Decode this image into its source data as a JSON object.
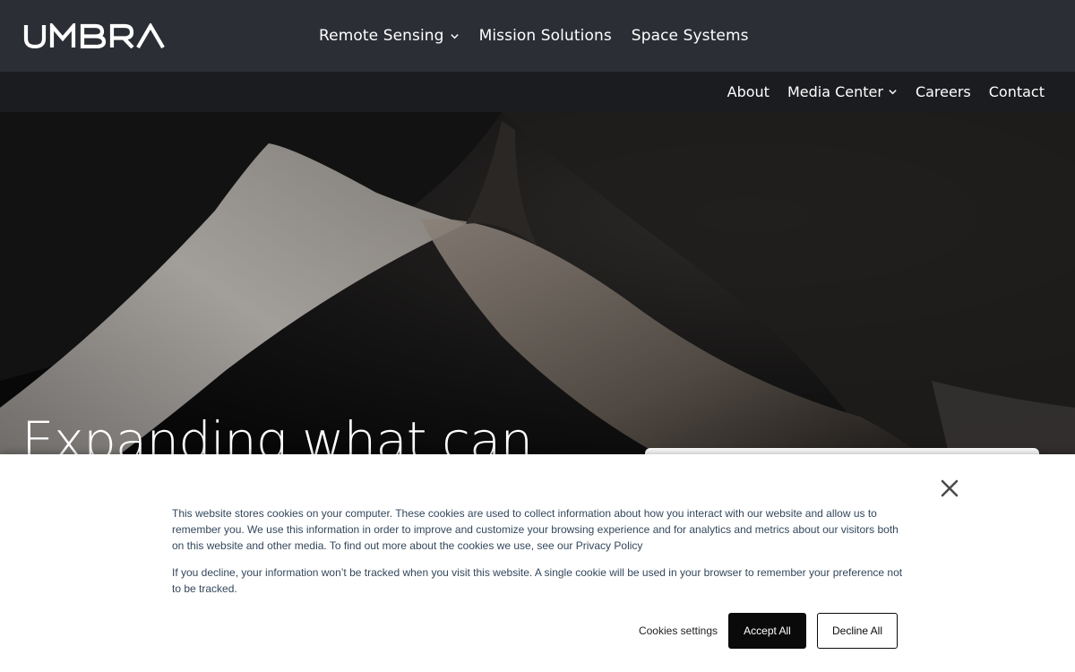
{
  "brand": {
    "logo_text": "UMBRA"
  },
  "main_nav": {
    "items": [
      {
        "label": "Remote Sensing",
        "has_dropdown": true
      },
      {
        "label": "Mission Solutions",
        "has_dropdown": false
      },
      {
        "label": "Space Systems",
        "has_dropdown": false
      }
    ]
  },
  "secondary_nav": {
    "items": [
      {
        "label": "About",
        "has_dropdown": false
      },
      {
        "label": "Media Center",
        "has_dropdown": true
      },
      {
        "label": "Careers",
        "has_dropdown": false
      },
      {
        "label": "Contact",
        "has_dropdown": false
      }
    ]
  },
  "hero": {
    "title": "Expanding what can"
  },
  "cookie_banner": {
    "paragraph_1": "This website stores cookies on your computer. These cookies are used to collect information about how you interact with our website and allow us to remember you. We use this information in order to improve and customize your browsing experience and for analytics and metrics about our visitors both on this website and other media. To find out more about the cookies we use, see our Privacy Policy",
    "paragraph_2": "If you decline, your information won’t be tracked when you visit this website. A single cookie will be used in your browser to remember your preference not to be tracked.",
    "settings_label": "Cookies settings",
    "accept_label": "Accept All",
    "decline_label": "Decline All",
    "close_icon": "close-icon"
  },
  "colors": {
    "topbar": "#2b2e35",
    "subbar": "#1b1c20",
    "accept_button": "#0a0a0a",
    "cookie_text": "#33475b"
  }
}
